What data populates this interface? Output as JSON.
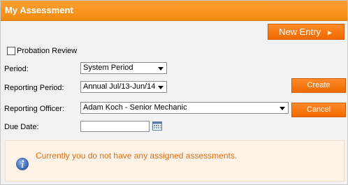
{
  "header": {
    "title": "My Assessment"
  },
  "toolbar": {
    "new_entry_label": "New Entry",
    "new_entry_arrow": "►"
  },
  "probation": {
    "label": "Probation Review",
    "checked": false
  },
  "fields": {
    "period_label": "Period:",
    "period_value": "System Period",
    "reporting_period_label": "Reporting Period:",
    "reporting_period_value": "Annual Jul/13-Jun/14",
    "reporting_officer_label": "Reporting Officer:",
    "reporting_officer_value": "Adam Koch - Senior Mechanic",
    "due_date_label": "Due Date:",
    "due_date_value": ""
  },
  "actions": {
    "create_label": "Create",
    "cancel_label": "Cancel"
  },
  "notice": {
    "message": "Currently you do not have any assigned assessments."
  },
  "colors": {
    "accent": "#f28a10",
    "notice_text": "#e06d10",
    "notice_bg": "#fff3e8"
  }
}
